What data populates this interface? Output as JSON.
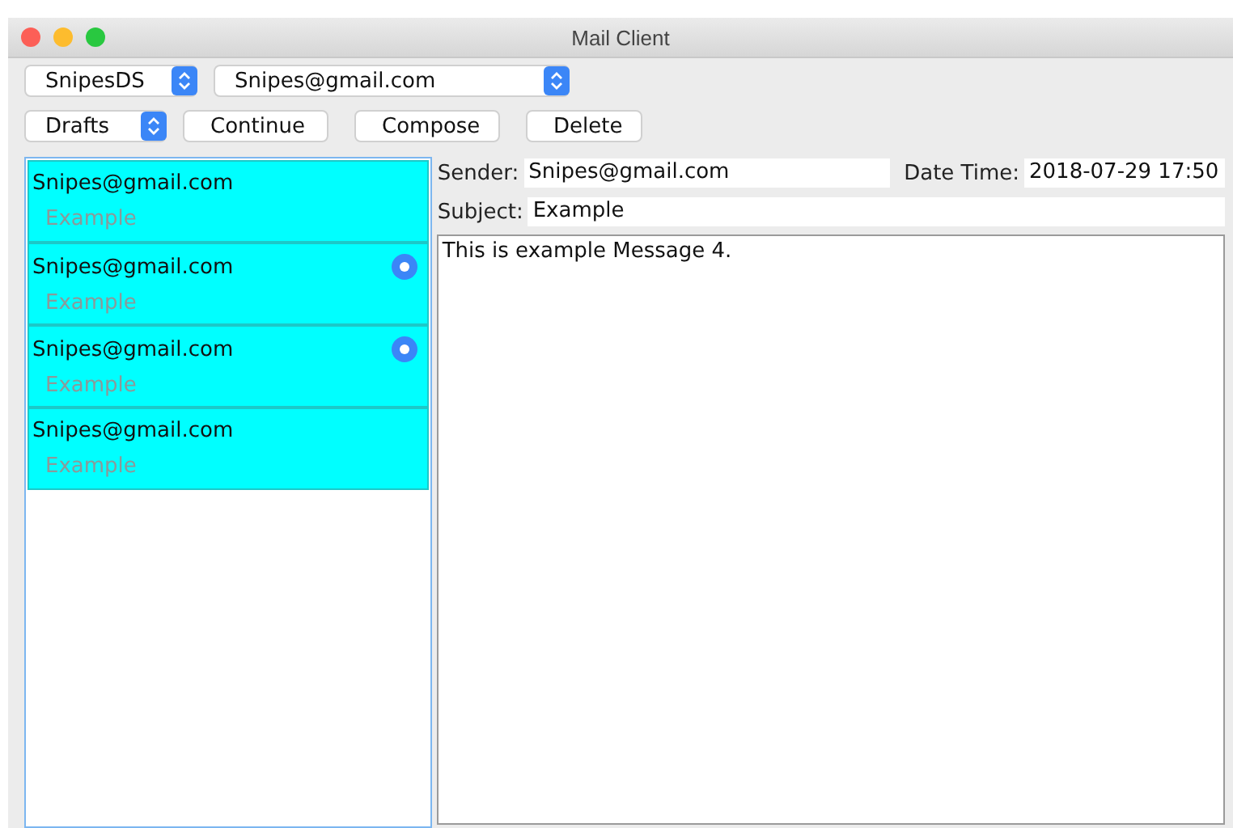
{
  "window": {
    "title": "Mail Client"
  },
  "account_select": {
    "value": "SnipesDS"
  },
  "address_select": {
    "value": "Snipes@gmail.com"
  },
  "folder_select": {
    "value": "Drafts"
  },
  "buttons": [
    "Continue",
    "Compose",
    "Delete"
  ],
  "messages": [
    {
      "sender": "Snipes@gmail.com",
      "subject": "Example",
      "marked": false
    },
    {
      "sender": "Snipes@gmail.com",
      "subject": "Example",
      "marked": true
    },
    {
      "sender": "Snipes@gmail.com",
      "subject": "Example",
      "marked": true
    },
    {
      "sender": "Snipes@gmail.com",
      "subject": "Example",
      "marked": false
    }
  ],
  "detail": {
    "sender_label": "Sender:",
    "sender": "Snipes@gmail.com",
    "date_label": "Date Time:",
    "date": "2018-07-29 17:50",
    "subject_label": "Subject:",
    "subject": "Example",
    "body": "This is example Message 4."
  }
}
